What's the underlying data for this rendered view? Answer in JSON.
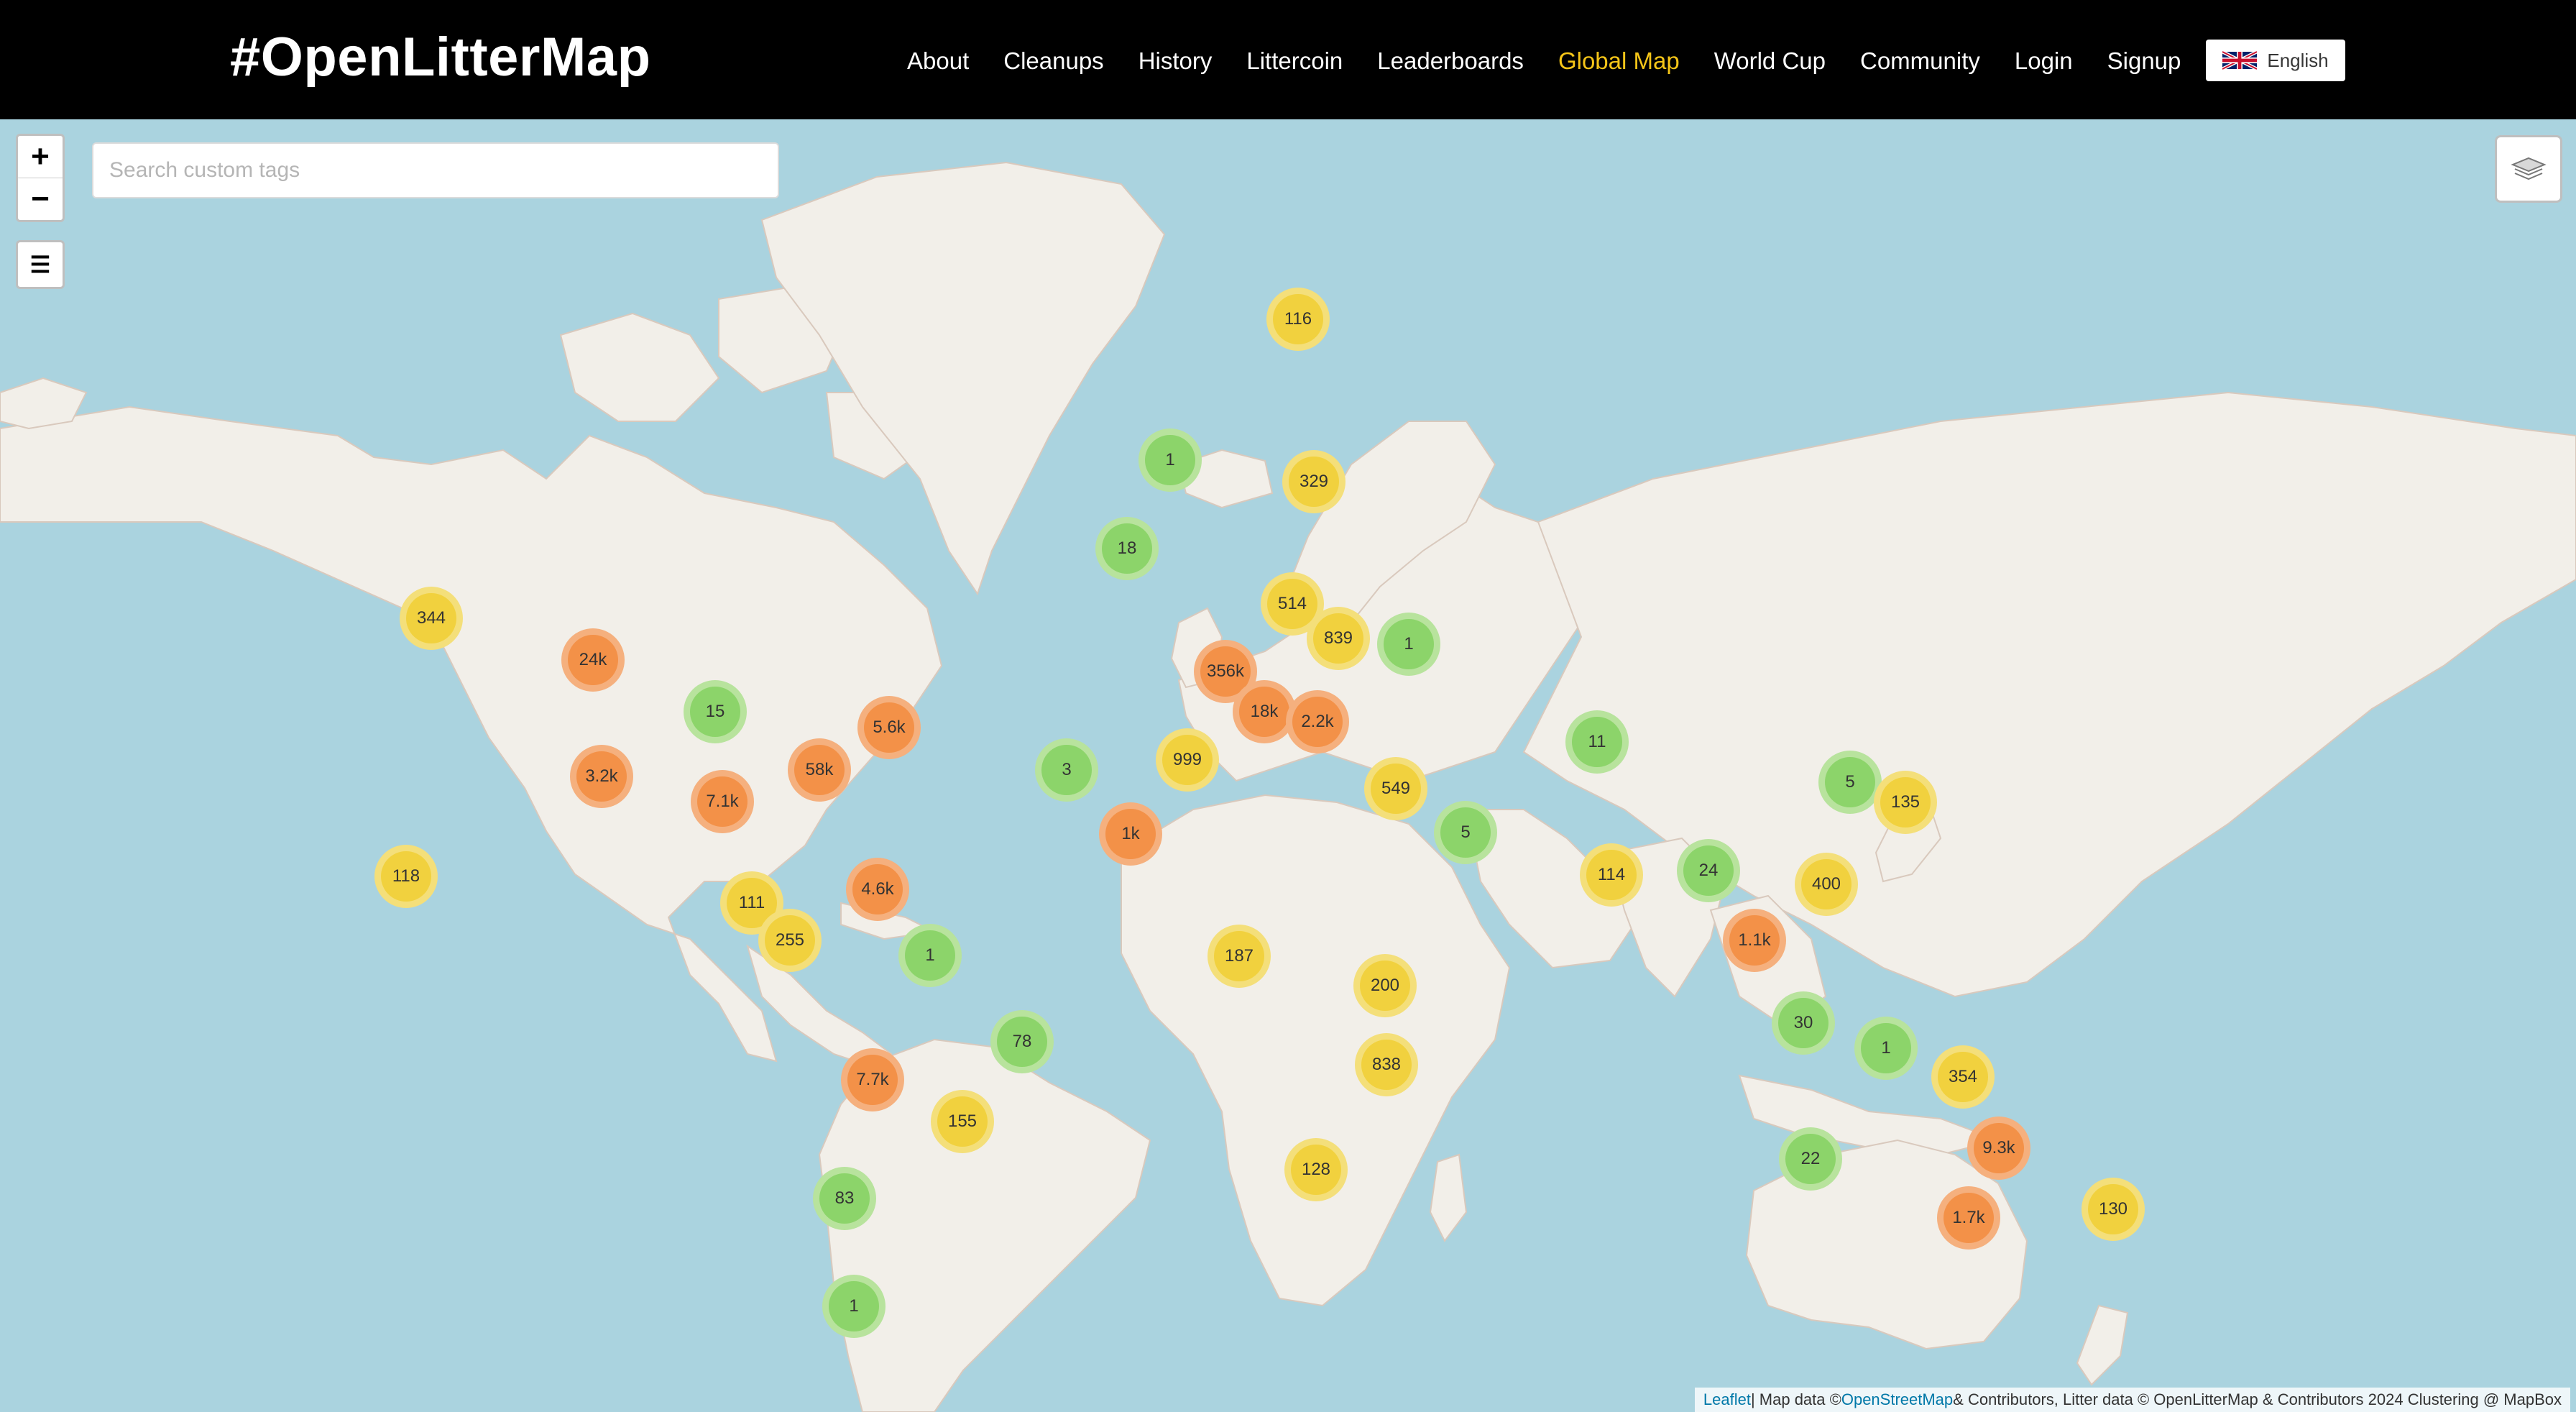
{
  "header": {
    "brand": "#OpenLitterMap",
    "nav": [
      {
        "label": "About",
        "active": false
      },
      {
        "label": "Cleanups",
        "active": false
      },
      {
        "label": "History",
        "active": false
      },
      {
        "label": "Littercoin",
        "active": false
      },
      {
        "label": "Leaderboards",
        "active": false
      },
      {
        "label": "Global Map",
        "active": true
      },
      {
        "label": "World Cup",
        "active": false
      },
      {
        "label": "Community",
        "active": false
      },
      {
        "label": "Login",
        "active": false
      },
      {
        "label": "Signup",
        "active": false
      }
    ],
    "language": {
      "label": "English",
      "flag_icon": "uk-flag-icon"
    }
  },
  "map_controls": {
    "zoom_in": "+",
    "zoom_out": "−",
    "menu": "☰",
    "search_placeholder": "Search custom tags",
    "layers_icon": "layers-icon"
  },
  "cluster_colors": {
    "small": {
      "fill": "#8cd46a",
      "halo": "#b8e39d"
    },
    "medium": {
      "fill": "#f1d13e",
      "halo": "#f4df7a"
    },
    "large": {
      "fill": "#f39148",
      "halo": "#f5b07e"
    }
  },
  "clusters": [
    {
      "label": "116",
      "size": "medium"
    },
    {
      "label": "1",
      "size": "small"
    },
    {
      "label": "329",
      "size": "medium"
    },
    {
      "label": "18",
      "size": "small"
    },
    {
      "label": "344",
      "size": "medium"
    },
    {
      "label": "24k",
      "size": "large"
    },
    {
      "label": "514",
      "size": "medium"
    },
    {
      "label": "839",
      "size": "medium"
    },
    {
      "label": "1",
      "size": "small"
    },
    {
      "label": "356k",
      "size": "large"
    },
    {
      "label": "15",
      "size": "small"
    },
    {
      "label": "5.6k",
      "size": "large"
    },
    {
      "label": "18k",
      "size": "large"
    },
    {
      "label": "2.2k",
      "size": "large"
    },
    {
      "label": "11",
      "size": "small"
    },
    {
      "label": "3.2k",
      "size": "large"
    },
    {
      "label": "58k",
      "size": "large"
    },
    {
      "label": "3",
      "size": "small"
    },
    {
      "label": "999",
      "size": "medium"
    },
    {
      "label": "5",
      "size": "small"
    },
    {
      "label": "7.1k",
      "size": "large"
    },
    {
      "label": "549",
      "size": "medium"
    },
    {
      "label": "135",
      "size": "medium"
    },
    {
      "label": "1k",
      "size": "large"
    },
    {
      "label": "5",
      "size": "small"
    },
    {
      "label": "118",
      "size": "medium"
    },
    {
      "label": "4.6k",
      "size": "large"
    },
    {
      "label": "114",
      "size": "medium"
    },
    {
      "label": "24",
      "size": "small"
    },
    {
      "label": "400",
      "size": "medium"
    },
    {
      "label": "111",
      "size": "medium"
    },
    {
      "label": "255",
      "size": "medium"
    },
    {
      "label": "1.1k",
      "size": "large"
    },
    {
      "label": "1",
      "size": "small"
    },
    {
      "label": "187",
      "size": "medium"
    },
    {
      "label": "200",
      "size": "medium"
    },
    {
      "label": "78",
      "size": "small"
    },
    {
      "label": "30",
      "size": "small"
    },
    {
      "label": "1",
      "size": "small"
    },
    {
      "label": "838",
      "size": "medium"
    },
    {
      "label": "7.7k",
      "size": "large"
    },
    {
      "label": "354",
      "size": "medium"
    },
    {
      "label": "155",
      "size": "medium"
    },
    {
      "label": "9.3k",
      "size": "large"
    },
    {
      "label": "128",
      "size": "medium"
    },
    {
      "label": "22",
      "size": "small"
    },
    {
      "label": "83",
      "size": "small"
    },
    {
      "label": "130",
      "size": "medium"
    },
    {
      "label": "1.7k",
      "size": "large"
    },
    {
      "label": "1",
      "size": "small"
    }
  ],
  "attribution": {
    "leaflet": "Leaflet",
    "sep": " | Map data © ",
    "osm": "OpenStreetMap",
    "rest": " & Contributors, Litter data © OpenLitterMap & Contributors 2024 Clustering @ MapBox"
  }
}
